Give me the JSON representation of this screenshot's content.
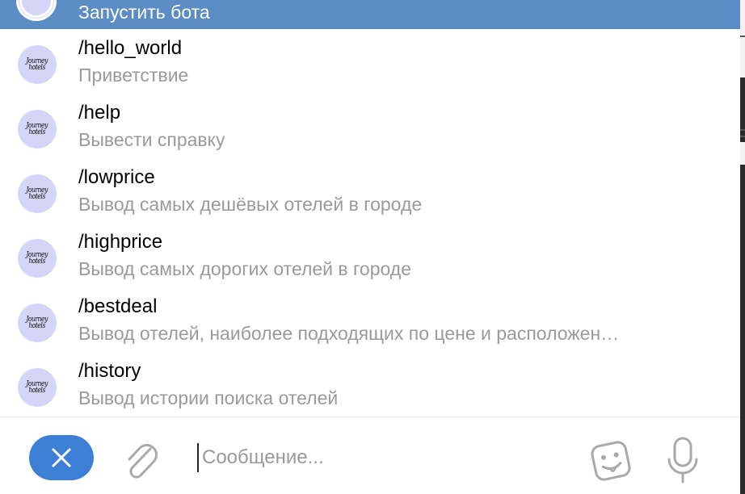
{
  "start_row": {
    "label": "Запустить бота"
  },
  "bot_avatar": {
    "text_line1": "Journey",
    "text_line2": "hotels"
  },
  "commands": [
    {
      "command": "/hello_world",
      "description": "Приветствие"
    },
    {
      "command": "/help",
      "description": "Вывести справку"
    },
    {
      "command": "/lowprice",
      "description": "Вывод самых дешёвых отелей в городе"
    },
    {
      "command": "/highprice",
      "description": "Вывод самых дорогих отелей в городе"
    },
    {
      "command": "/bestdeal",
      "description": "Вывод отелей, наиболее подходящих по цене и расположен…"
    },
    {
      "command": "/history",
      "description": "Вывод истории поиска отелей"
    }
  ],
  "composer": {
    "placeholder": "Сообщение..."
  },
  "colors": {
    "highlight": "#5b8dc4",
    "accent": "#3d7fd4",
    "avatar_bg": "#d5d6f7",
    "secondary_text": "#9a9a9a"
  },
  "icons": [
    "close-icon",
    "paperclip-icon",
    "emoji-sticker-icon",
    "microphone-icon"
  ]
}
